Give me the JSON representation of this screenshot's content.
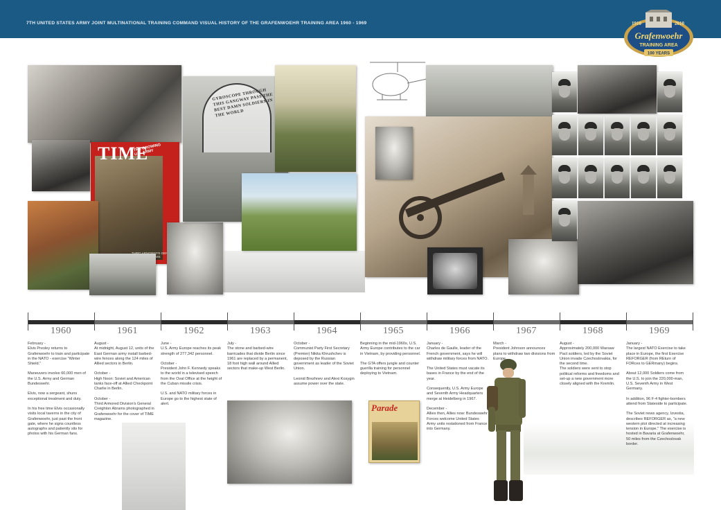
{
  "header": {
    "title": "7TH UNITED STATES ARMY JOINT MULTINATIONAL TRAINING COMMAND VISUAL HISTORY OF THE GRAFENWOEHR TRAINING AREA 1960 - 1969"
  },
  "logo": {
    "year_left": "1910",
    "year_right": "2010",
    "name_line1": "Grafenwoehr",
    "name_line2": "TRAINING AREA",
    "ribbon": "100 YEARS"
  },
  "photos": {
    "time_cover": {
      "masthead": "TIME",
      "banner": "THE GROWING U.S. ARMY",
      "caption": "THIRD ARMORED'S GENERAL ABRAMS"
    },
    "gyroscope_sign": {
      "text": "GYROSCOPE THROUGH THIS GANGWAY PASS THE BEST DAMN SOLDIERS IN THE WORLD"
    },
    "parade_magazine": {
      "masthead": "Parade"
    }
  },
  "timeline": {
    "years": [
      "1960",
      "1961",
      "1962",
      "1963",
      "1964",
      "1965",
      "1966",
      "1967",
      "1968",
      "1969"
    ]
  },
  "columns": [
    {
      "year": "1960",
      "paragraphs": [
        "February -\nElvis Presley returns to Grafenwoehr to train and participate in the NATO - exercise \"Winter Shield.\"",
        "Maneuvers involve 60,000 men of the U.S. Army and German Bundeswehr.",
        "Elvis, now a sergeant, shuns exceptional treatment and duty.",
        "In his free time Elvis occasionally visits local taverns in the city of Grafenwoehr, just past the front gate, where he signs countless autographs and patiently sits for photos with his German fans."
      ]
    },
    {
      "year": "1961",
      "paragraphs": [
        "August -\nAt midnight, August 12, units of the East German army install barbed-wire fences along the 124 miles of Allied sectors in Berlin.",
        "October -\nHigh Noon: Soviet and American tanks face-off at Allied Checkpoint Charlie in Berlin.",
        "October -\nThird Armored Division's General Creighton Abrams photographed in Grafenwoehr for the cover of TIME magazine."
      ]
    },
    {
      "year": "1962",
      "paragraphs": [
        "June -\nU.S. Army Europe reaches its peak strength of 277,342 personnel.",
        "October -\nPresident John F. Kennedy speaks to the world in a televised speech from the Oval Office at the height of the Cuban missile crisis.",
        "U.S. and NATO military forces in Europe go to the highest state of alert."
      ]
    },
    {
      "year": "1963",
      "paragraphs": [
        "July -\nThe stone and barbed-wire barricades that divide Berlin since 1961 are replaced by a permanent, 18 foot high wall around Allied sectors that make-up West Berlin."
      ]
    },
    {
      "year": "1964",
      "paragraphs": [
        "October -\nCommunist Party First Secretary (Premier) Nikita Khrushchev is deposed by the Russian government as leader of the Soviet Union.",
        "Leonid Brezhnev and Alexi Kosygin assume power over the state."
      ]
    },
    {
      "year": "1965",
      "paragraphs": [
        "Beginning in the mid-1960s, U.S. Army Europe contributes to the car in Vietnam, by providing personnel.",
        "The GTA offers jungle and counter guerilla training for personnel deploying to Vietnam."
      ]
    },
    {
      "year": "1966",
      "paragraphs": [
        "January -\nCharles de Gaulle, leader of the French government, says he will withdraw military forces from NATO.",
        "The United States must vacate its bases in France by the end of the year.",
        "Consequently, U.S. Army Europe and Seventh Army Headquarters merge at Heidelberg in 1967.",
        "December -\nAllies then, Allies now: Bundeswehr Forces welcome United States Army units restationed from France into Germany."
      ]
    },
    {
      "year": "1967",
      "paragraphs": [
        "March -\nPresident Johnson announces plans to withdraw two divisions from Europe."
      ]
    },
    {
      "year": "1968",
      "paragraphs": [
        "August -\nApproximately 200,000 Warsaw Pact soldiers, led by the Soviet Union invade Czechoslovakia, for the second time.\nThe soldiers were sent to stop political reforms and freedoms and set-up a new government more closely aligned with the Kremlin."
      ]
    },
    {
      "year": "1969",
      "paragraphs": [
        "January -\nThe largest NATO Exercise to take place in Europe, the first Exercise REFORGER (from REturn of FORces to GERmany) begins.",
        "About 12,000 Soldiers come from the U.S. to join the 220,000-man, U.S. Seventh Army in West Germany.",
        "In addition, 96 F-4 fighter-bombers attend from Stateside to participate.",
        "The Soviet news agency, Izvestia, describes REFORGER as, \"a new western plot directed at increasing tension in Europe.\" The exercise is hosted in Bavaria at Grafenwoehr, 50 miles from the Czechoslovak border."
      ]
    }
  ],
  "colors": {
    "header_bg": "#1b5a84",
    "timeline_dark": "#2b2b2b",
    "timeline_mid": "#6b6b6b",
    "logo_gold": "#c9a24a",
    "logo_blue": "#1d4f86"
  }
}
